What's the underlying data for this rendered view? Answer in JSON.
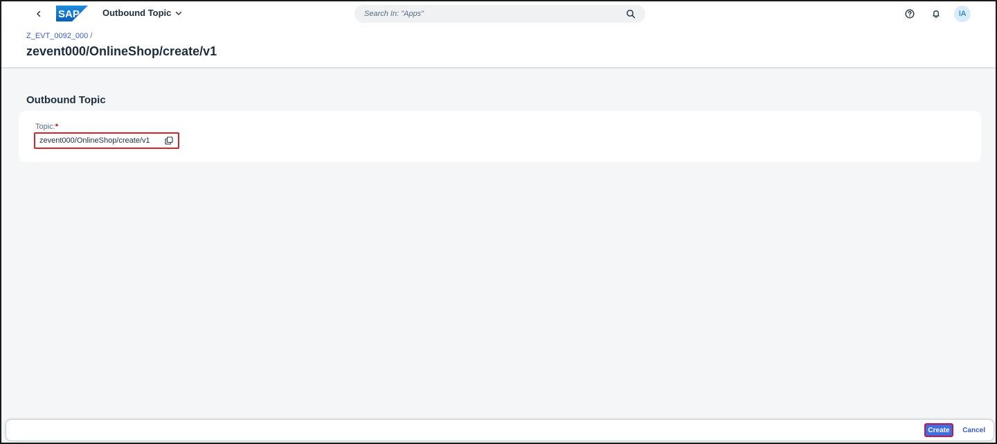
{
  "shell": {
    "logo_text": "SAP",
    "app_title": "Outbound Topic",
    "search_placeholder": "Search In: \"Apps\"",
    "user_initials": "IA",
    "brand_color": "#0a6ed1"
  },
  "header": {
    "breadcrumb_link": "Z_EVT_0092_000",
    "breadcrumb_sep": "/",
    "title": "zevent000/OnlineShop/create/v1"
  },
  "section": {
    "title": "Outbound Topic",
    "field_label": "Topic:",
    "required_mark": "*",
    "field_value": "zevent000/OnlineShop/create/v1"
  },
  "footer": {
    "create_label": "Create",
    "cancel_label": "Cancel"
  }
}
